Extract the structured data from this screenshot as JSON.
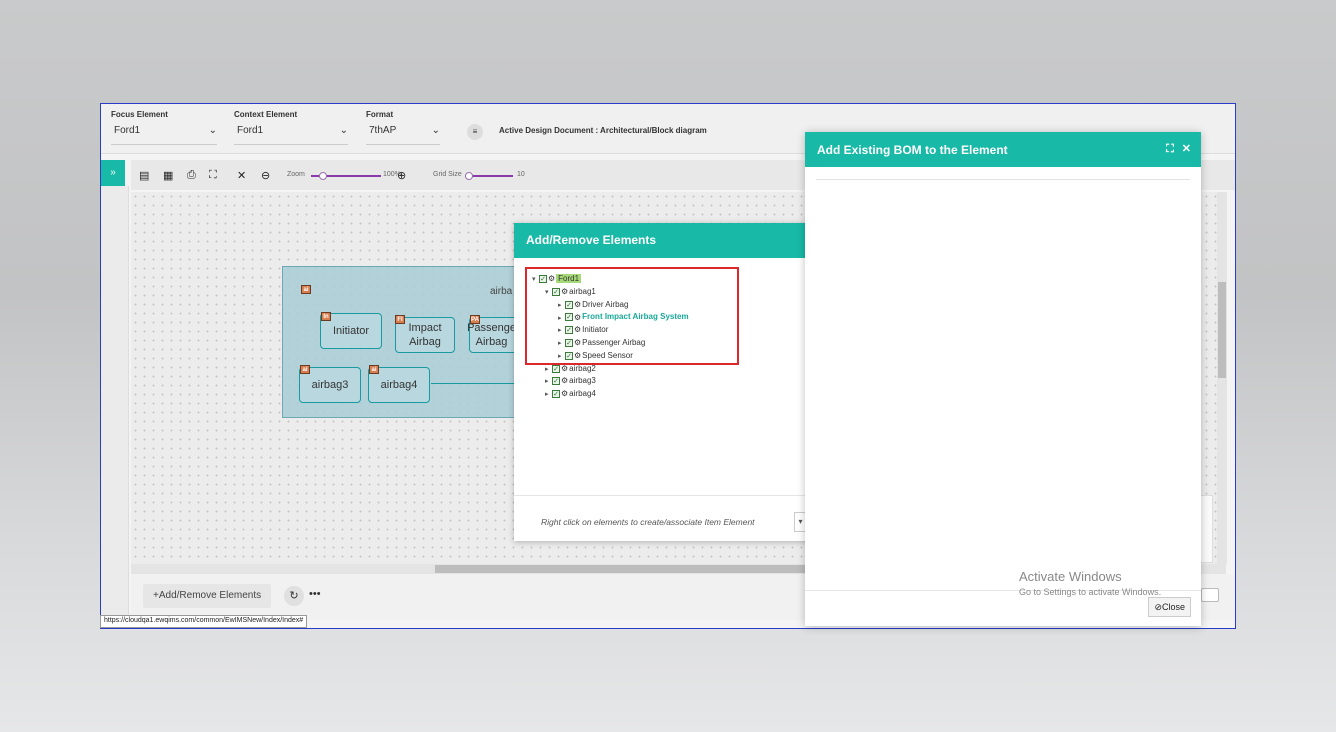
{
  "topbar": {
    "focus": {
      "label": "Focus Element",
      "value": "Ford1"
    },
    "context": {
      "label": "Context Element",
      "value": "Ford1"
    },
    "format": {
      "label": "Format",
      "value": "7thAP"
    },
    "active_doc": "Active Design Document : Architectural/Block diagram"
  },
  "toolbar": {
    "zoom_label": "Zoom",
    "zoom_value": "100%",
    "grid_label": "Grid Size",
    "grid_value": "10",
    "icons": [
      "pdf-icon",
      "image-icon",
      "print-icon",
      "fullscreen-icon",
      "fit-icon",
      "zoom-out-icon",
      "zoom-in-icon"
    ]
  },
  "diagram": {
    "group_label": "airba",
    "blocks": [
      {
        "tag": "In",
        "label": "Initiator"
      },
      {
        "tag": "FI",
        "label": "Impact Airbag"
      },
      {
        "tag": "PA",
        "label": "Passenge Airbag"
      },
      {
        "tag": "ai",
        "label": "airbag3"
      },
      {
        "tag": "ai",
        "label": "airbag4"
      }
    ],
    "group_tag": "ai"
  },
  "bottombar": {
    "add_remove": "Add/Remove Elements",
    "more": "•••"
  },
  "status_url": "https://cloudqa1.ewqims.com/common/EwIMSNew/Index/Index#",
  "add_remove_dialog": {
    "title": "Add/Remove Elements",
    "tree": [
      {
        "label": "Ford1",
        "level": 0
      },
      {
        "label": "airbag1",
        "level": 1
      },
      {
        "label": "Driver Airbag",
        "level": 2
      },
      {
        "label": "Front Impact Airbag System",
        "level": 2
      },
      {
        "label": "Initiator",
        "level": 2
      },
      {
        "label": "Passenger Airbag",
        "level": 2
      },
      {
        "label": "Speed Sensor",
        "level": 2
      },
      {
        "label": "airbag2",
        "level": 1
      },
      {
        "label": "airbag3",
        "level": 1
      },
      {
        "label": "airbag4",
        "level": 1
      }
    ],
    "hint": "Right click on elements to create/associate Item Element"
  },
  "bom_dialog": {
    "title": "Add Existing BOM to the Element",
    "close_label": "Close"
  },
  "watermark": {
    "line1": "Activate Windows",
    "line2": "Go to Settings to activate Windows."
  },
  "colors": {
    "accent": "#18b9a6",
    "highlight": "#d9282e",
    "block_border": "#189aa0"
  }
}
